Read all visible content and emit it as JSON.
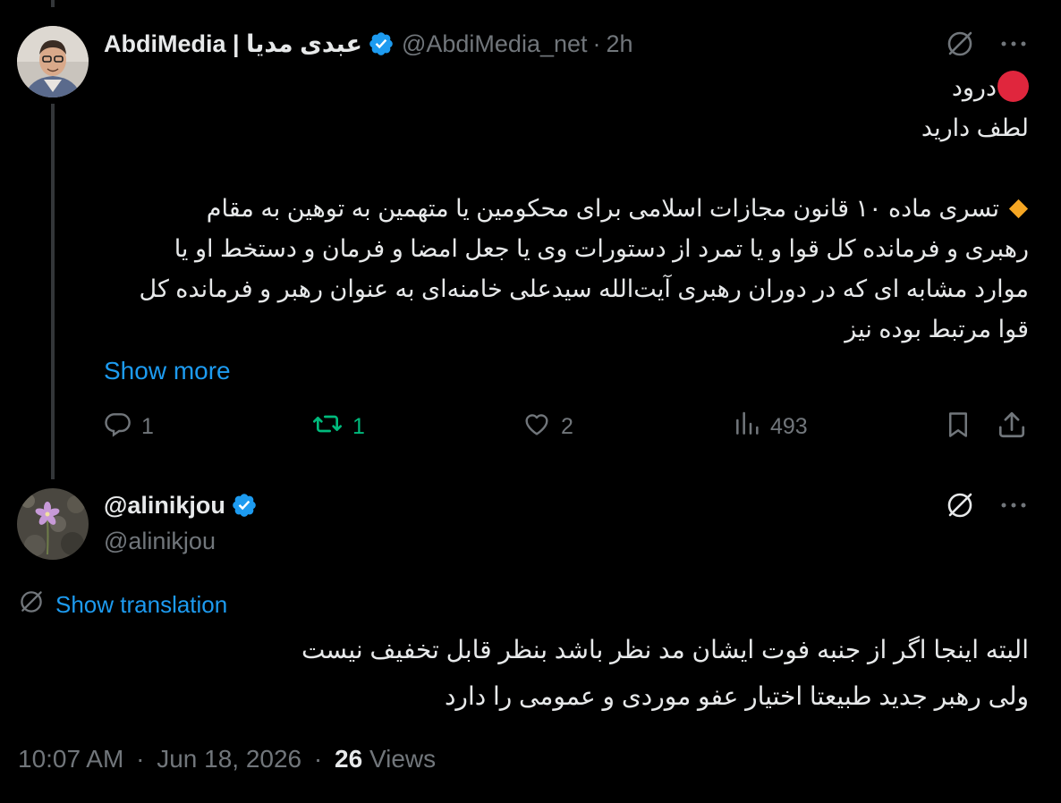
{
  "thread": {
    "parent": {
      "display_name": "AbdiMedia | عبدی مدیا",
      "handle": "@AbdiMedia_net",
      "separator": "·",
      "time": "2h",
      "lines": {
        "greeting": "درود",
        "intro": "لطف دارید",
        "p1": "تسری ماده ۱۰ قانون مجازات اسلامی برای محکومین یا متهمین به توهین به مقام",
        "p2": "رهبری و فرمانده کل قوا و یا تمرد از دستورات وی یا جعل امضا و فرمان و دستخط او یا",
        "p3": "موارد مشابه ای که در دوران رهبری آیت‌الله سیدعلی خامنه‌ای به عنوان رهبر و فرمانده کل",
        "p4": "قوا مرتبط بوده نیز"
      },
      "show_more": "Show more",
      "actions": {
        "reply_count": "1",
        "repost_count": "1",
        "like_count": "2",
        "views_count": "493"
      }
    },
    "reply": {
      "display_name": "@alinikjou",
      "handle": "@alinikjou",
      "show_translation": "Show translation",
      "lines": {
        "l1": "البته اینجا اگر از جنبه فوت ایشان مد نظر باشد بنظر قابل تخفیف نیست",
        "l2": "ولی رهبر جدید طبیعتا اختیار عفو موردی و عمومی را دارد"
      },
      "meta": {
        "time": "10:07 AM",
        "date": "Jun 18, 2026",
        "separator": "·",
        "views_count": "26",
        "views_label": "Views"
      }
    }
  },
  "icons": {
    "verified": "verified-badge-icon",
    "grok": "grok-icon",
    "more": "more-horizontal-icon",
    "reply": "reply-icon",
    "repost": "repost-icon",
    "like": "heart-icon",
    "views": "views-icon",
    "bookmark": "bookmark-icon",
    "share": "share-icon",
    "translate": "translate-icon"
  },
  "colors": {
    "background": "#000000",
    "text": "#e7e9ea",
    "muted": "#71767b",
    "link": "#1d9bf0",
    "repost_active": "#00ba7c",
    "verified": "#1d9bf0",
    "red_circle": "#e0263d",
    "orange_diamond": "#f5a623"
  }
}
